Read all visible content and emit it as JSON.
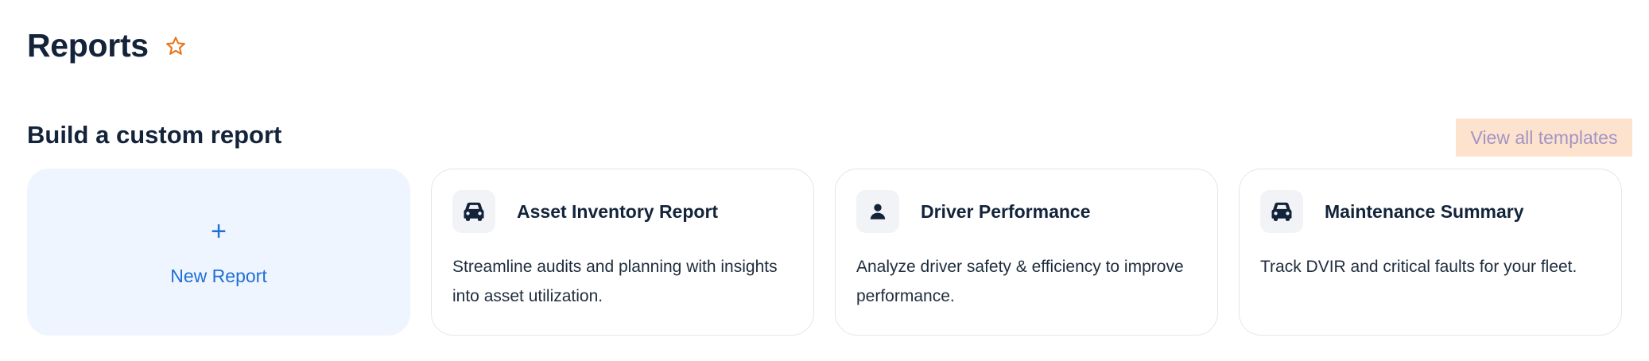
{
  "header": {
    "title": "Reports",
    "favorite_icon": "star-outline-icon",
    "accent": "#e8761b"
  },
  "section": {
    "title": "Build a custom report",
    "view_all_label": "View all templates"
  },
  "new_report": {
    "plus": "+",
    "label": "New Report"
  },
  "templates": [
    {
      "icon": "car-icon",
      "title": "Asset Inventory Report",
      "description": "Streamline audits and planning with insights into asset utilization."
    },
    {
      "icon": "person-icon",
      "title": "Driver Performance",
      "description": "Analyze driver safety & efficiency to improve performance."
    },
    {
      "icon": "car-icon",
      "title": "Maintenance Summary",
      "description": "Track DVIR and critical faults for your fleet."
    }
  ]
}
